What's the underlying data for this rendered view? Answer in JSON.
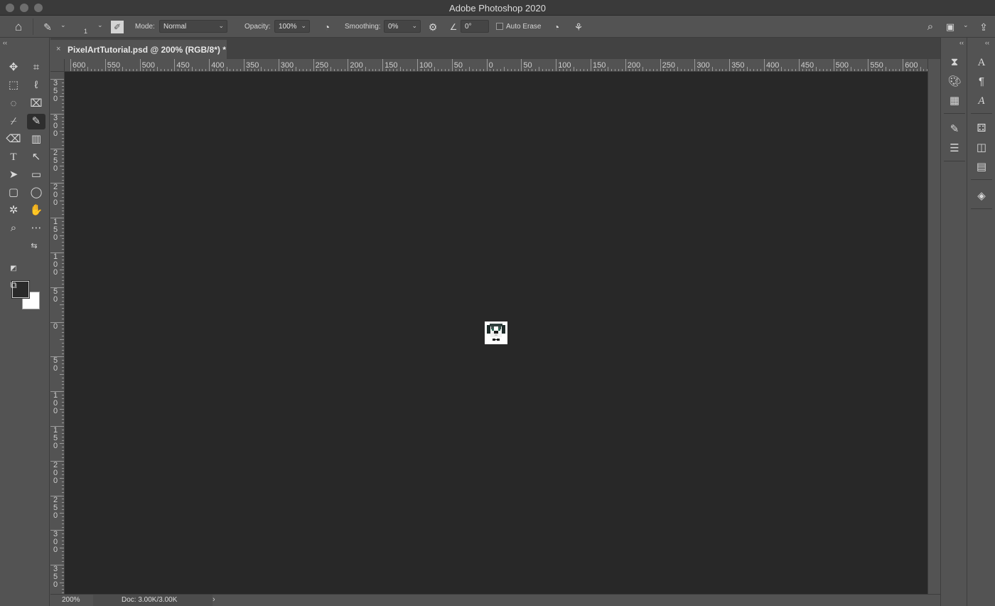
{
  "window": {
    "title": "Adobe Photoshop 2020"
  },
  "options_bar": {
    "brush_size": "1",
    "mode_label": "Mode:",
    "mode_value": "Normal",
    "opacity_label": "Opacity:",
    "opacity_value": "100%",
    "smoothing_label": "Smoothing:",
    "smoothing_value": "0%",
    "angle_value": "0°",
    "auto_erase_label": "Auto Erase",
    "auto_erase_checked": false
  },
  "document_tab": {
    "title": "PixelArtTutorial.psd @ 200% (RGB/8*) *",
    "close_glyph": "×"
  },
  "rulers": {
    "horizontal_labels": [
      "600",
      "550",
      "500",
      "450",
      "400",
      "350",
      "300",
      "250",
      "200",
      "150",
      "100",
      "50",
      "0",
      "50",
      "100",
      "150",
      "200",
      "250",
      "300",
      "350",
      "400",
      "450",
      "500",
      "550",
      "600"
    ],
    "vertical_labels": [
      "350",
      "300",
      "250",
      "200",
      "150",
      "100",
      "50",
      "0",
      "50",
      "100",
      "150",
      "200",
      "250",
      "300",
      "350"
    ]
  },
  "status_bar": {
    "zoom": "200%",
    "doc_info": "Doc: 3.00K/3.00K",
    "arrow": "›"
  },
  "colors": {
    "foreground": "#2a2a2a",
    "background": "#ffffff",
    "canvas_bg": "#282828",
    "ui_panel": "#535353"
  },
  "tools": [
    "move-tool-icon",
    "artboard-tool-icon",
    "marquee-tool-icon",
    "lasso-tool-icon",
    "quick-selection-tool-icon",
    "crop-tool-icon",
    "eyedropper-tool-icon",
    "pencil-tool-icon",
    "eraser-tool-icon",
    "gradient-tool-icon",
    "type-tool-icon",
    "path-selection-tool-icon",
    "direct-selection-tool-icon",
    "rectangle-tool-icon",
    "rounded-rectangle-tool-icon",
    "ellipse-tool-icon",
    "custom-shape-tool-icon",
    "hand-tool-icon",
    "zoom-tool-icon",
    "more-tools-icon"
  ]
}
